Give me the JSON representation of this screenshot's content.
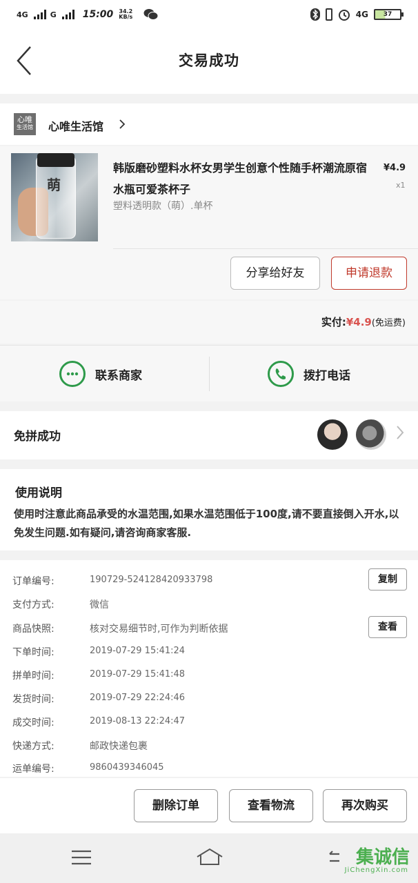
{
  "status_bar": {
    "network1": "4G",
    "network2": "G",
    "time": "15:00",
    "speed_value": "34.2",
    "speed_unit": "KB/s",
    "right_network": "4G",
    "battery": "37"
  },
  "header": {
    "title": "交易成功"
  },
  "shop": {
    "logo_text_top": "心唯",
    "logo_text_bottom": "生活馆",
    "name": "心唯生活馆"
  },
  "product": {
    "title": "韩版磨砂塑料水杯女男学生创意个性随手杯潮流原宿水瓶可爱茶杯子",
    "price": "¥4.9",
    "quantity": "x1",
    "spec": "塑料透明款（萌）.单杯",
    "thumb_text": "萌",
    "share_label": "分享给好友",
    "refund_label": "申请退款"
  },
  "payment": {
    "label": "实付:",
    "amount": "¥4.9",
    "shipping": "(免运费)"
  },
  "contact": {
    "merchant_label": "联系商家",
    "call_label": "拨打电话"
  },
  "group": {
    "label": "免拼成功"
  },
  "instructions": {
    "title": "使用说明",
    "body": "使用时注意此商品承受的水温范围,如果水温范围低于100度,请不要直接倒入开水,以免发生问题.如有疑问,请咨询商家客服."
  },
  "details": {
    "rows": [
      {
        "label": "订单编号:",
        "value": "190729-524128420933798"
      },
      {
        "label": "支付方式:",
        "value": "微信"
      },
      {
        "label": "商品快照:",
        "value": "核对交易细节时,可作为判断依据"
      },
      {
        "label": "下单时间:",
        "value": "2019-07-29  15:41:24"
      },
      {
        "label": "拼单时间:",
        "value": "2019-07-29  15:41:48"
      },
      {
        "label": "发货时间:",
        "value": "2019-07-29  22:24:46"
      },
      {
        "label": "成交时间:",
        "value": "2019-08-13  22:24:47"
      },
      {
        "label": "快递方式:",
        "value": "邮政快递包裹"
      },
      {
        "label": "运单编号:",
        "value": "9860439346045"
      }
    ],
    "copy_label": "复制",
    "view_label": "查看"
  },
  "actions": {
    "delete_label": "删除订单",
    "logistics_label": "查看物流",
    "rebuy_label": "再次购买"
  },
  "watermark": {
    "text": "集诚信",
    "sub": "JiChengXin.com"
  }
}
